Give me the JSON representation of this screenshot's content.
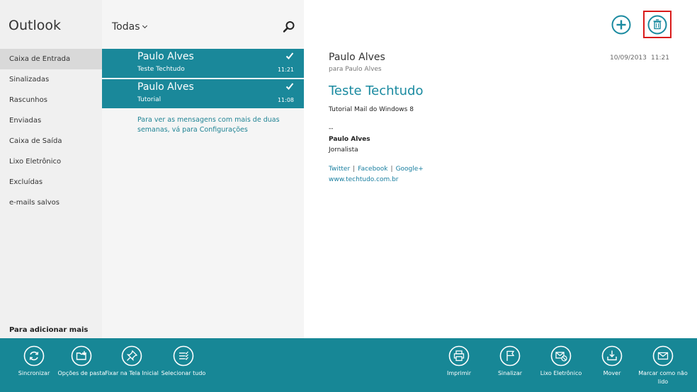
{
  "nav": {
    "title": "Outlook",
    "folders": [
      "Caixa de Entrada",
      "Sinalizadas",
      "Rascunhos",
      "Enviadas",
      "Caixa de Saída",
      "Lixo Eletrônico",
      "Excluídas",
      "e-mails salvos"
    ],
    "active_index": 0,
    "add_more_text": "Para adicionar mais"
  },
  "list": {
    "filter_label": "Todas",
    "messages": [
      {
        "sender": "Paulo Alves",
        "subject": "Teste Techtudo",
        "time": "11:21",
        "selected": true
      },
      {
        "sender": "Paulo Alves",
        "subject": "Tutorial",
        "time": "11:08",
        "selected": true
      }
    ],
    "older_note": "Para ver as mensagens com mais de duas semanas, vá para Configurações"
  },
  "reader": {
    "from": "Paulo Alves",
    "to": "para Paulo Alves",
    "date": "10/09/2013",
    "time": "11:21",
    "subject": "Teste Techtudo",
    "body": "Tutorial Mail do Windows 8",
    "separator": "--",
    "signature_name": "Paulo Alves",
    "signature_role": "Jornalista",
    "links": [
      "Twitter",
      "Facebook",
      "Google+"
    ],
    "link_separator": "|",
    "website": "www.techtudo.com.br"
  },
  "appbar": {
    "left": [
      {
        "label": "Sincronizar",
        "icon": "sync-icon"
      },
      {
        "label": "Opções de pasta",
        "icon": "folder-options-icon"
      },
      {
        "label": "Fixar na Tela Inicial",
        "icon": "pin-icon"
      },
      {
        "label": "Selecionar tudo",
        "icon": "select-all-icon"
      }
    ],
    "right": [
      {
        "label": "Imprimir",
        "icon": "print-icon"
      },
      {
        "label": "Sinalizar",
        "icon": "flag-icon"
      },
      {
        "label": "Lixo Eletrônico",
        "icon": "junk-icon"
      },
      {
        "label": "Mover",
        "icon": "move-icon"
      },
      {
        "label": "Marcar como não lido",
        "icon": "mark-unread-icon"
      }
    ]
  },
  "colors": {
    "accent": "#1a889a",
    "appbar": "#178796",
    "highlight_box": "#d91a1a"
  }
}
